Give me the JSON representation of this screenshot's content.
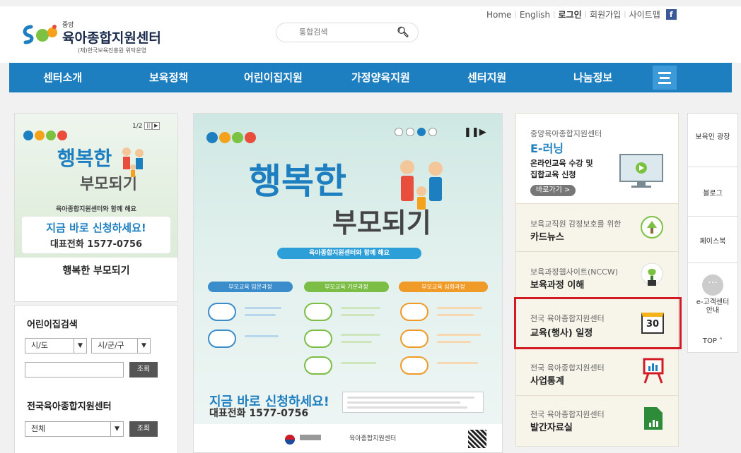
{
  "header": {
    "links": [
      "Home",
      "English",
      "로그인",
      "회원가입",
      "사이트맵"
    ],
    "fb_label": "f",
    "logo": {
      "small": "중앙",
      "name": "육아종합지원센터",
      "sub": "(재)한국보육진흥원 위탁운영"
    },
    "search": {
      "placeholder": "통합검색",
      "icon": "search-icon"
    }
  },
  "nav": {
    "items": [
      "센터소개",
      "보육정책",
      "어린이집지원",
      "가정양육지원",
      "센터지원",
      "나눔정보"
    ],
    "menu_icon": "list-menu-icon"
  },
  "left_banner": {
    "pager": "1/2",
    "title": "행복한 부모되기",
    "heading_1": "행복한",
    "heading_2": "부모되기",
    "tagline": "육아종합지원센터와 함께 해요",
    "cta": "지금 바로 신청하세요!",
    "phone": "대표전화 1577-0756"
  },
  "daycare_search": {
    "title": "어린이집검색",
    "sido": "시/도",
    "sigungu": "시/군/구",
    "search_btn": "조회"
  },
  "center_search": {
    "title": "전국육아종합지원센터",
    "selected": "전체",
    "search_btn": "조회"
  },
  "poster": {
    "heading_1": "행복한",
    "heading_2": "부모되기",
    "tagline": "육아종합지원센터와 함께 해요",
    "stages": [
      "부모교육 입문과정",
      "부모교육 기본과정",
      "부모교육 심화과정"
    ],
    "cta": "지금 바로 신청하세요!",
    "phone": "대표전화 1577-0756",
    "footer_org": "육아종합지원센터"
  },
  "services": [
    {
      "sub": "중앙육아종합지원센터",
      "title": "E-러닝",
      "desc_1": "온라인교육 수강 및",
      "desc_2": "집합교육 신청",
      "button": "바로가기 >",
      "icon": "monitor-icon"
    },
    {
      "sub": "보육교직원 감정보호를 위한",
      "title": "카드뉴스",
      "icon": "tree-badge-icon"
    },
    {
      "sub": "보육과정웹사이트(NCCW)",
      "title": "보육과정 이해",
      "icon": "plant-icon"
    },
    {
      "sub": "전국 육아종합지원센터",
      "title": "교육(행사) 일정",
      "icon": "calendar-icon",
      "calendar_day": "30"
    },
    {
      "sub": "전국 육아종합지원센터",
      "title": "사업통계",
      "icon": "chart-board-icon"
    },
    {
      "sub": "전국 육아종합지원센터",
      "title": "발간자료실",
      "icon": "document-icon"
    }
  ],
  "quick_links": [
    "보육인 광장",
    "블로그",
    "페이스북",
    "e-고객센터안내"
  ],
  "top_label": "TOP",
  "colors": {
    "nav": "#1e7fc0",
    "highlight": "#d21b25"
  }
}
